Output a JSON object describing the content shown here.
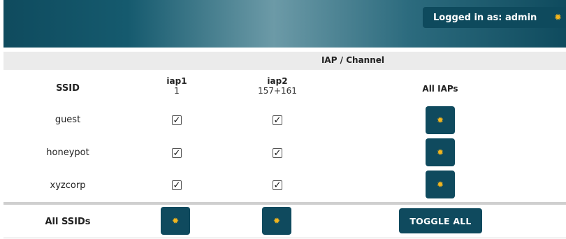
{
  "header": {
    "login_text": "Logged in as: admin",
    "settings_icon": "gear-icon",
    "accent_color": "#f2b51e",
    "brand_color": "#0f4a5e"
  },
  "band": {
    "title": "IAP / Channel"
  },
  "table": {
    "ssid_header": "SSID",
    "columns": [
      {
        "name": "iap1",
        "channel": "1"
      },
      {
        "name": "iap2",
        "channel": "157+161"
      },
      {
        "name": "All IAPs",
        "channel": ""
      }
    ],
    "rows": [
      {
        "ssid": "guest",
        "iap1_checked": true,
        "iap2_checked": true,
        "check_glyph": "✓"
      },
      {
        "ssid": "honeypot",
        "iap1_checked": true,
        "iap2_checked": true,
        "check_glyph": "✓"
      },
      {
        "ssid": "xyzcorp",
        "iap1_checked": true,
        "iap2_checked": true,
        "check_glyph": "✓"
      }
    ],
    "footer": {
      "label": "All SSIDs",
      "toggle_all_label": "TOGGLE ALL"
    }
  },
  "icons": {
    "gear_glyph": "✹"
  }
}
